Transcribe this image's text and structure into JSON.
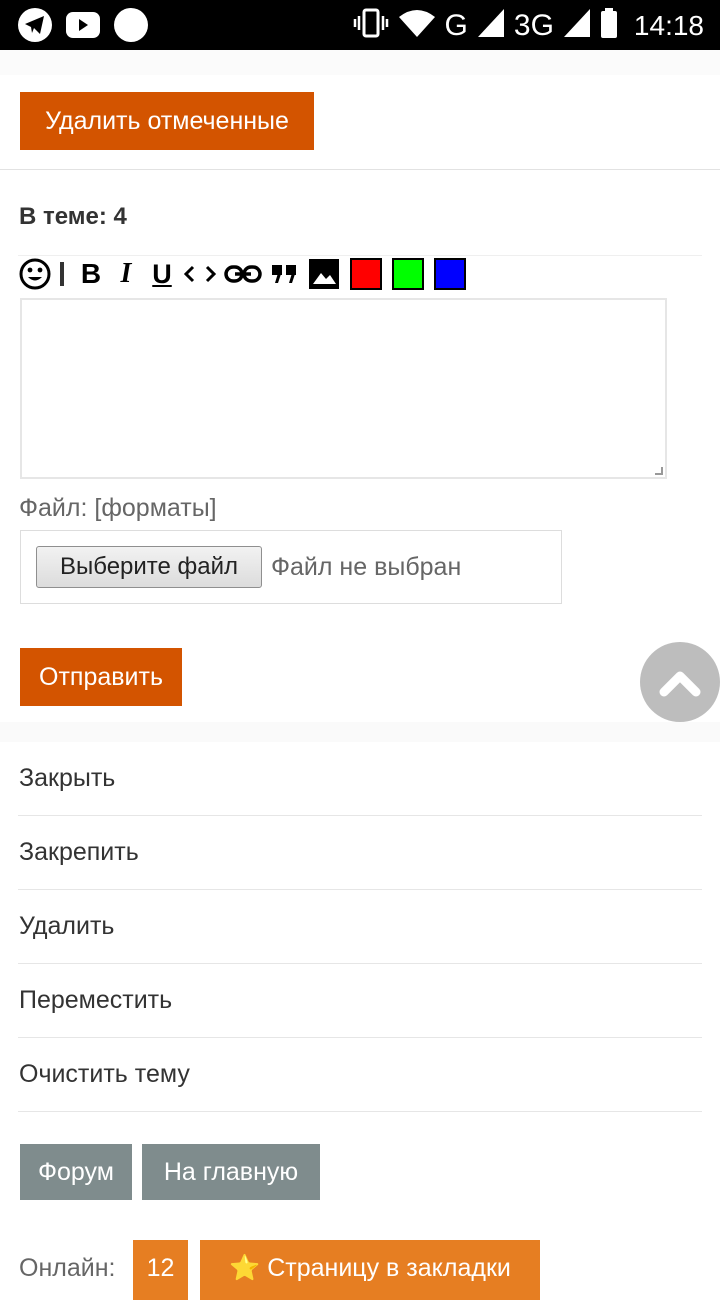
{
  "status_bar": {
    "network_label": "G",
    "network_label_2": "3G",
    "time": "14:18"
  },
  "actions": {
    "delete_selected": "Удалить отмеченные"
  },
  "topic": {
    "count_text": "В теме: 4"
  },
  "editor": {
    "toolbar_icons": [
      "smile-icon",
      "bold-icon",
      "italic-icon",
      "underline-icon",
      "code-icon",
      "link-icon",
      "quote-icon",
      "image-icon",
      "color-red",
      "color-green",
      "color-blue"
    ],
    "colors": {
      "red": "#ff0000",
      "green": "#00ff00",
      "blue": "#0000ff"
    },
    "bold_glyph": "B",
    "italic_glyph": "I",
    "underline_glyph": "U",
    "code_glyph": "‹›",
    "quote_glyph": "❞"
  },
  "file": {
    "label": "Файл:",
    "formats_link": "[форматы]",
    "choose_button": "Выберите файл",
    "status": "Файл не выбран"
  },
  "submit": {
    "label": "Отправить"
  },
  "moderation_menu": [
    {
      "label": "Закрыть"
    },
    {
      "label": "Закрепить"
    },
    {
      "label": "Удалить"
    },
    {
      "label": "Переместить"
    },
    {
      "label": "Очистить тему"
    }
  ],
  "nav": {
    "forum": "Форум",
    "home": "На главную"
  },
  "footer": {
    "online_label": "Онлайн:",
    "online_count": "12",
    "bookmark": "⭐ Страницу в закладки"
  },
  "colors": {
    "accent_orange": "#d35400",
    "gray_button": "#7f8c8d",
    "amber": "#e67e22"
  }
}
